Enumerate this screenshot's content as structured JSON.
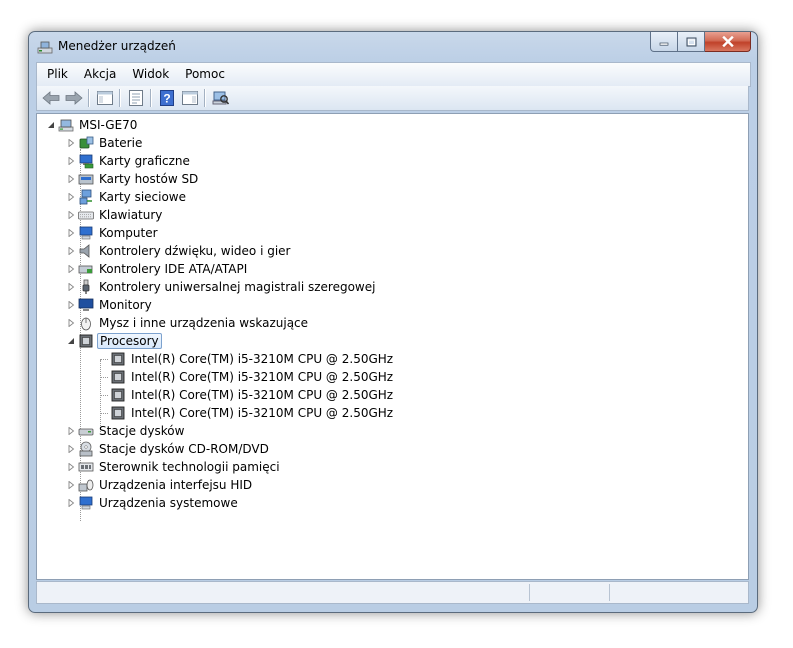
{
  "window": {
    "title": "Menedżer urządzeń"
  },
  "menu": [
    "Plik",
    "Akcja",
    "Widok",
    "Pomoc"
  ],
  "toolbar": {
    "buttons": [
      "back-icon",
      "forward-icon",
      "show-hide-tree-icon",
      "properties-icon",
      "help-icon",
      "action-pane-icon",
      "scan-hardware-icon"
    ]
  },
  "tree": {
    "root": "MSI-GE70",
    "categories": [
      {
        "label": "Baterie",
        "icon": "battery-icon"
      },
      {
        "label": "Karty graficzne",
        "icon": "display-adapter-icon"
      },
      {
        "label": "Karty hostów SD",
        "icon": "sd-host-icon"
      },
      {
        "label": "Karty sieciowe",
        "icon": "network-adapter-icon"
      },
      {
        "label": "Klawiatury",
        "icon": "keyboard-icon"
      },
      {
        "label": "Komputer",
        "icon": "computer-icon"
      },
      {
        "label": "Kontrolery dźwięku, wideo i gier",
        "icon": "speaker-icon"
      },
      {
        "label": "Kontrolery IDE ATA/ATAPI",
        "icon": "ide-controller-icon"
      },
      {
        "label": "Kontrolery uniwersalnej magistrali szeregowej",
        "icon": "usb-icon"
      },
      {
        "label": "Monitory",
        "icon": "monitor-icon"
      },
      {
        "label": "Mysz i inne urządzenia wskazujące",
        "icon": "mouse-icon"
      },
      {
        "label": "Procesory",
        "icon": "processor-icon",
        "expanded": true,
        "selected": true,
        "children": [
          "Intel(R) Core(TM) i5-3210M CPU @ 2.50GHz",
          "Intel(R) Core(TM) i5-3210M CPU @ 2.50GHz",
          "Intel(R) Core(TM) i5-3210M CPU @ 2.50GHz",
          "Intel(R) Core(TM) i5-3210M CPU @ 2.50GHz"
        ]
      },
      {
        "label": "Stacje dysków",
        "icon": "disk-drive-icon"
      },
      {
        "label": "Stacje dysków CD-ROM/DVD",
        "icon": "cdrom-icon"
      },
      {
        "label": "Sterownik technologii pamięci",
        "icon": "memory-controller-icon"
      },
      {
        "label": "Urządzenia interfejsu HID",
        "icon": "hid-icon"
      },
      {
        "label": "Urządzenia systemowe",
        "icon": "system-device-icon"
      }
    ]
  },
  "colors": {
    "selection_border": "#7da2ce",
    "title_bar": "#bccfe6",
    "close_button": "#c0422a"
  }
}
